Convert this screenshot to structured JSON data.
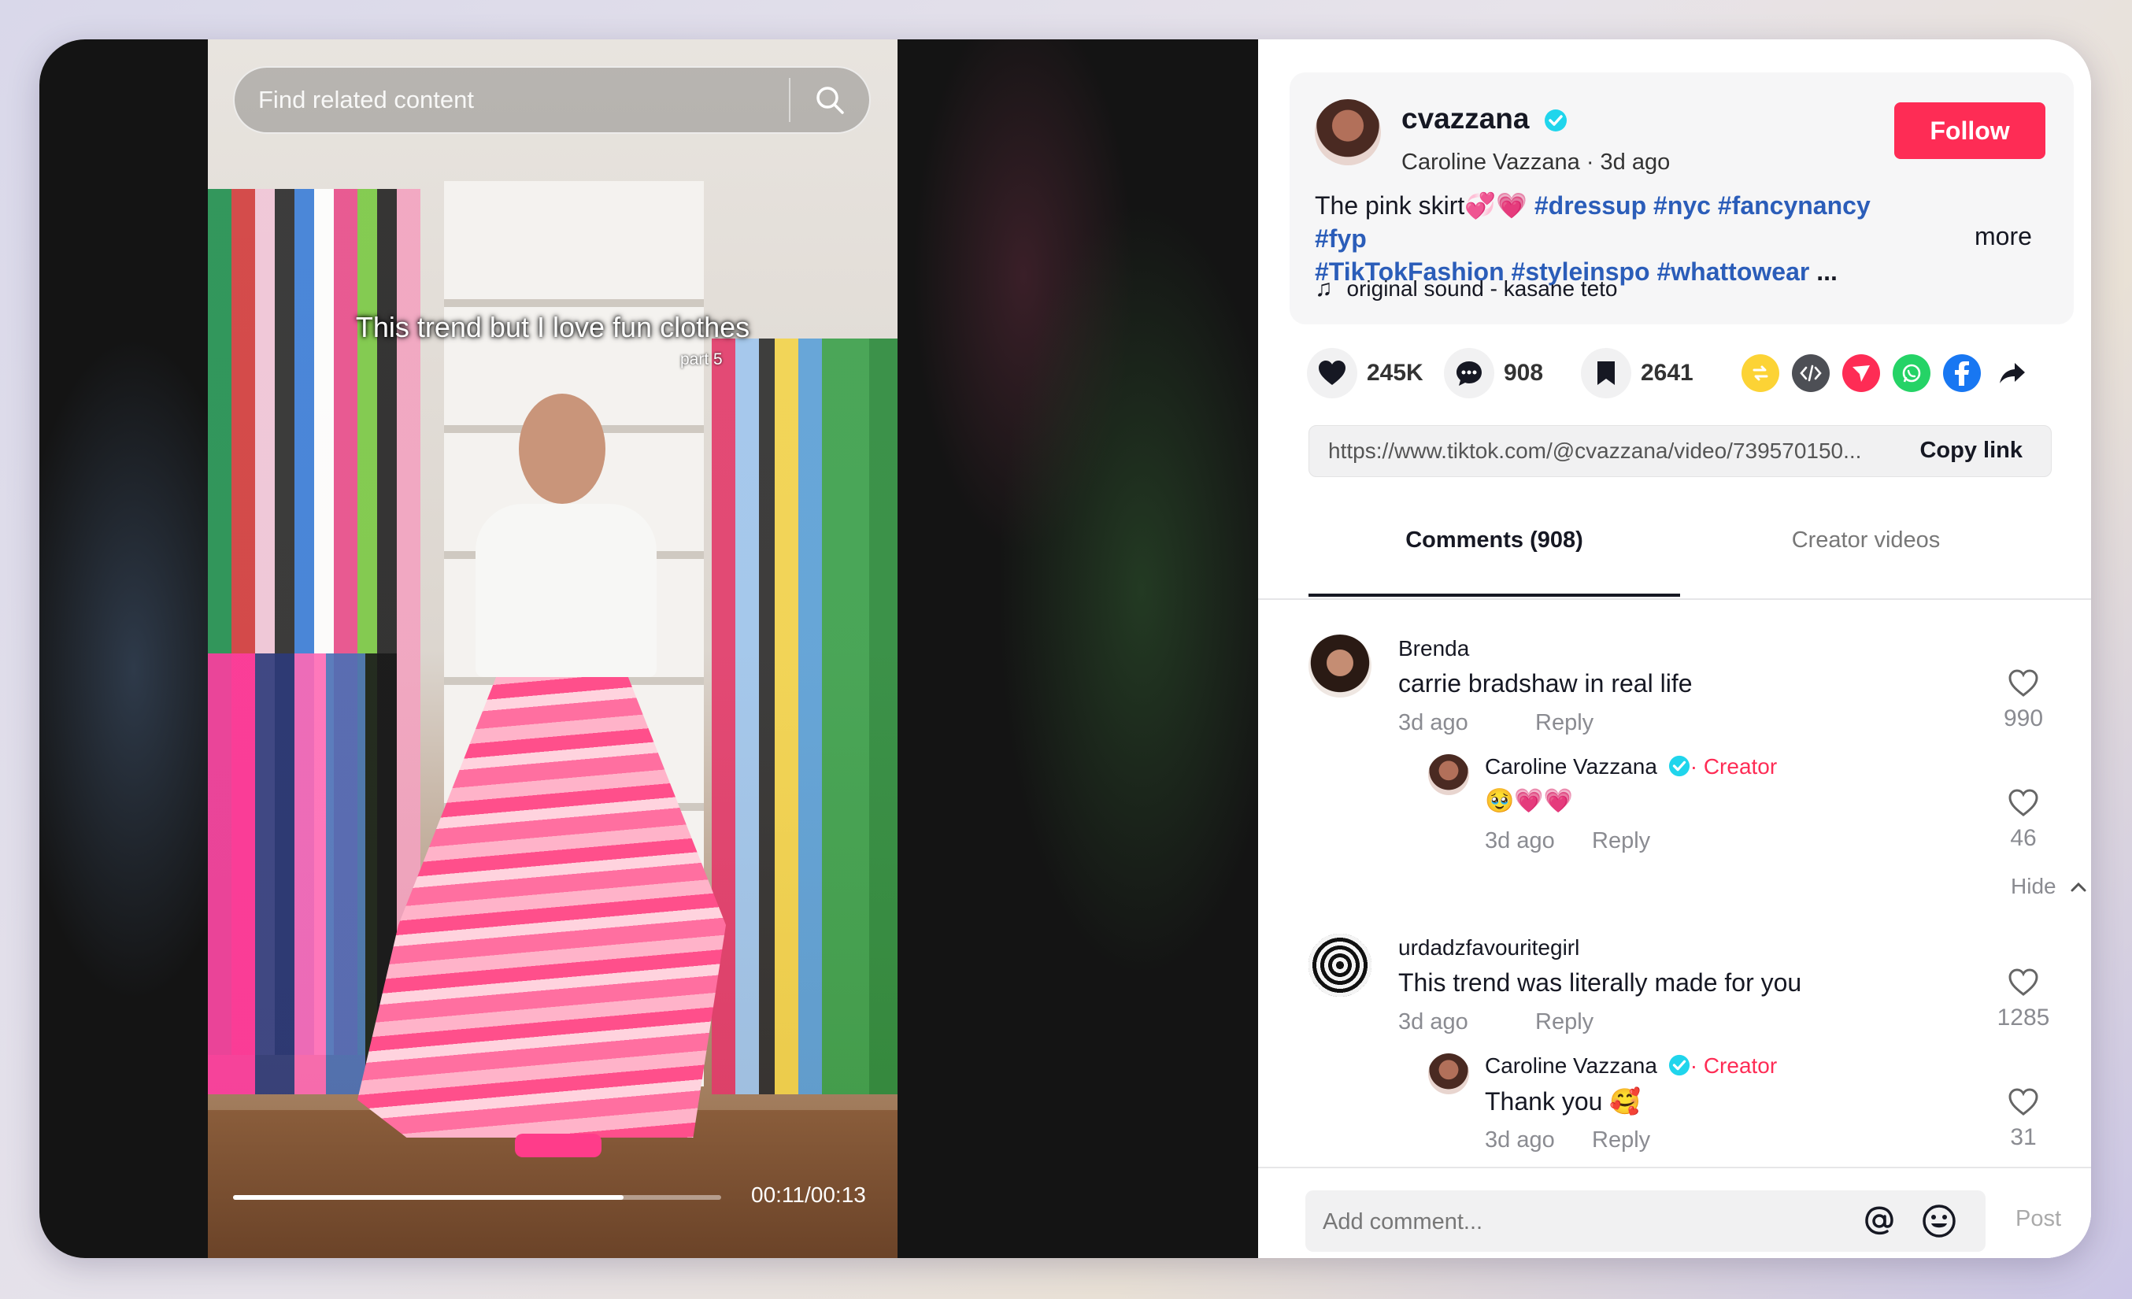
{
  "video": {
    "search_placeholder": "Find related content",
    "caption": "This trend but I love fun clothes",
    "caption_sub": "part 5",
    "time": "00:11/00:13",
    "progress": 0.8
  },
  "post": {
    "username": "cvazzana",
    "display_name": "Caroline Vazzana",
    "separator": " · ",
    "posted": "3d ago",
    "follow_label": "Follow",
    "description_text": "The pink skirt💞💗 ",
    "hashtags_line1": [
      "#dressup",
      "#nyc",
      "#fancynancy",
      "#fyp"
    ],
    "hashtags_line2": [
      "#TikTokFashion",
      "#styleinspo",
      "#whattowear"
    ],
    "ellipsis": "...",
    "more_label": "more",
    "music": "original sound - kasane teto"
  },
  "actions": {
    "likes": "245K",
    "comments": "908",
    "saves": "2641",
    "share_icons": [
      "repost-icon",
      "embed-icon",
      "send-icon",
      "whatsapp-icon",
      "facebook-icon",
      "share-arrow-icon"
    ]
  },
  "link": {
    "url": "https://www.tiktok.com/@cvazzana/video/739570150...",
    "copy_label": "Copy link"
  },
  "tabs": {
    "comments_label": "Comments (908)",
    "creator_label": "Creator videos"
  },
  "comments": [
    {
      "user": "Brenda",
      "text": "carrie bradshaw in real life",
      "time": "3d ago",
      "reply_label": "Reply",
      "likes": "990",
      "reply": {
        "user": "Caroline Vazzana",
        "badge": "· Creator",
        "text": "🥹💗💗",
        "time": "3d ago",
        "reply_label": "Reply",
        "likes": "46"
      },
      "hide_label": "Hide"
    },
    {
      "user": "urdadzfavouritegirl",
      "text": "This trend was literally made for you",
      "time": "3d ago",
      "reply_label": "Reply",
      "likes": "1285",
      "reply": {
        "user": "Caroline Vazzana",
        "badge": "· Creator",
        "text": "Thank you 🥰",
        "time": "3d ago",
        "reply_label": "Reply",
        "likes": "31"
      }
    }
  ],
  "composer": {
    "placeholder": "Add comment...",
    "post_label": "Post"
  },
  "colors": {
    "accent": "#fe2c55",
    "hashtag": "#2b5db9",
    "verified": "#20d5ec"
  }
}
